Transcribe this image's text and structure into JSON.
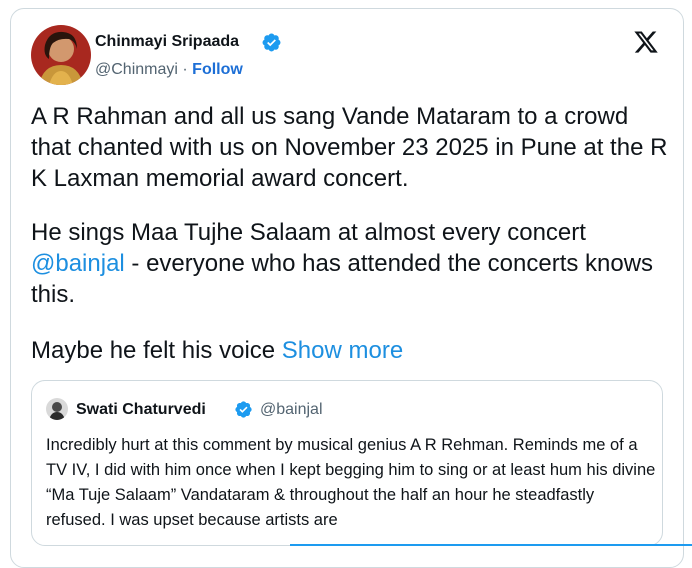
{
  "post": {
    "author_name": "Chinmayi Sripaada",
    "handle": "@Chinmayi",
    "separator": "·",
    "follow_label": "Follow",
    "paragraph_1": "A R Rahman and all us sang Vande Mataram to a crowd that chanted with us on November 23 2025 in Pune at the R K Laxman memorial award concert.",
    "paragraph_2_start": "He sings Maa Tujhe Salaam at almost every concert ",
    "paragraph_2_mention": "@bainjal",
    "paragraph_2_end": " - everyone who has attended the concerts knows this.",
    "paragraph_3": "Maybe he felt his voice ",
    "show_more_label": "Show more"
  },
  "quote": {
    "author_name": "Swati Chaturvedi",
    "handle": "@bainjal",
    "text": "Incredibly hurt at this comment by musical genius A R Rehman. Reminds me of a TV IV, I did with him once when I kept begging him to sing or at least hum his divine “Ma Tuje Salaam” Vandataram & throughout the half an hour he steadfastly refused. I was upset because artists are"
  },
  "icons": {
    "verified": "verified-badge-icon",
    "x_logo": "x-logo-icon"
  },
  "colors": {
    "link": "#1d8fe0",
    "verified": "#1d9bf0",
    "text": "#0f1419",
    "secondary": "#536471"
  }
}
